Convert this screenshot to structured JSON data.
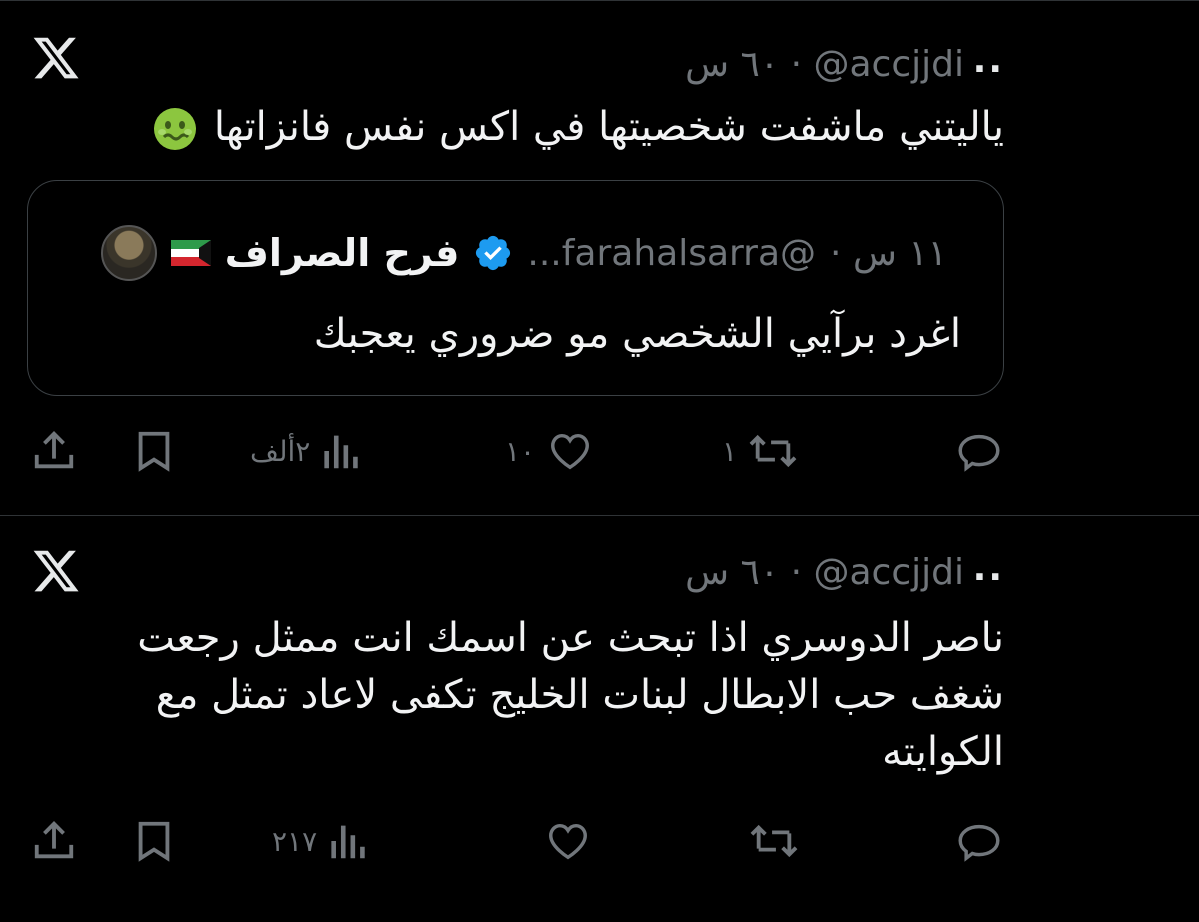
{
  "tweets": [
    {
      "handle": "@accjjdi",
      "time": "٦٠ س",
      "more": "..",
      "text": "ياليتني ماشفت شخصيتها في اكس نفس فانزاتها",
      "emoji": "nauseated-face",
      "quote": {
        "name": "فرح الصراف",
        "flag": "kuwait-flag",
        "handle": "@farahalsarra...",
        "time": "١١ س",
        "text": "اغرد برآيي الشخصي مو ضروري يعجبك"
      },
      "actions": {
        "reply_count": "",
        "retweet_count": "١",
        "like_count": "١٠",
        "views_count": "٢ألف"
      }
    },
    {
      "handle": "@accjjdi",
      "time": "٦٠ س",
      "more": "..",
      "text_lines": [
        "ناصر الدوسري اذا تبحث عن اسمك انت ممثل رجعت",
        "شغف حب الابطال  لبنات الخليج تكفى لاعاد تمثل مع",
        "الكوايته"
      ],
      "actions": {
        "reply_count": "",
        "retweet_count": "",
        "like_count": "",
        "views_count": "٢١٧"
      }
    }
  ],
  "colors": {
    "background": "#000000",
    "text": "#e7e9ea",
    "muted": "#71767b",
    "verified": "#1d9bf0",
    "divider": "#2f3336"
  }
}
